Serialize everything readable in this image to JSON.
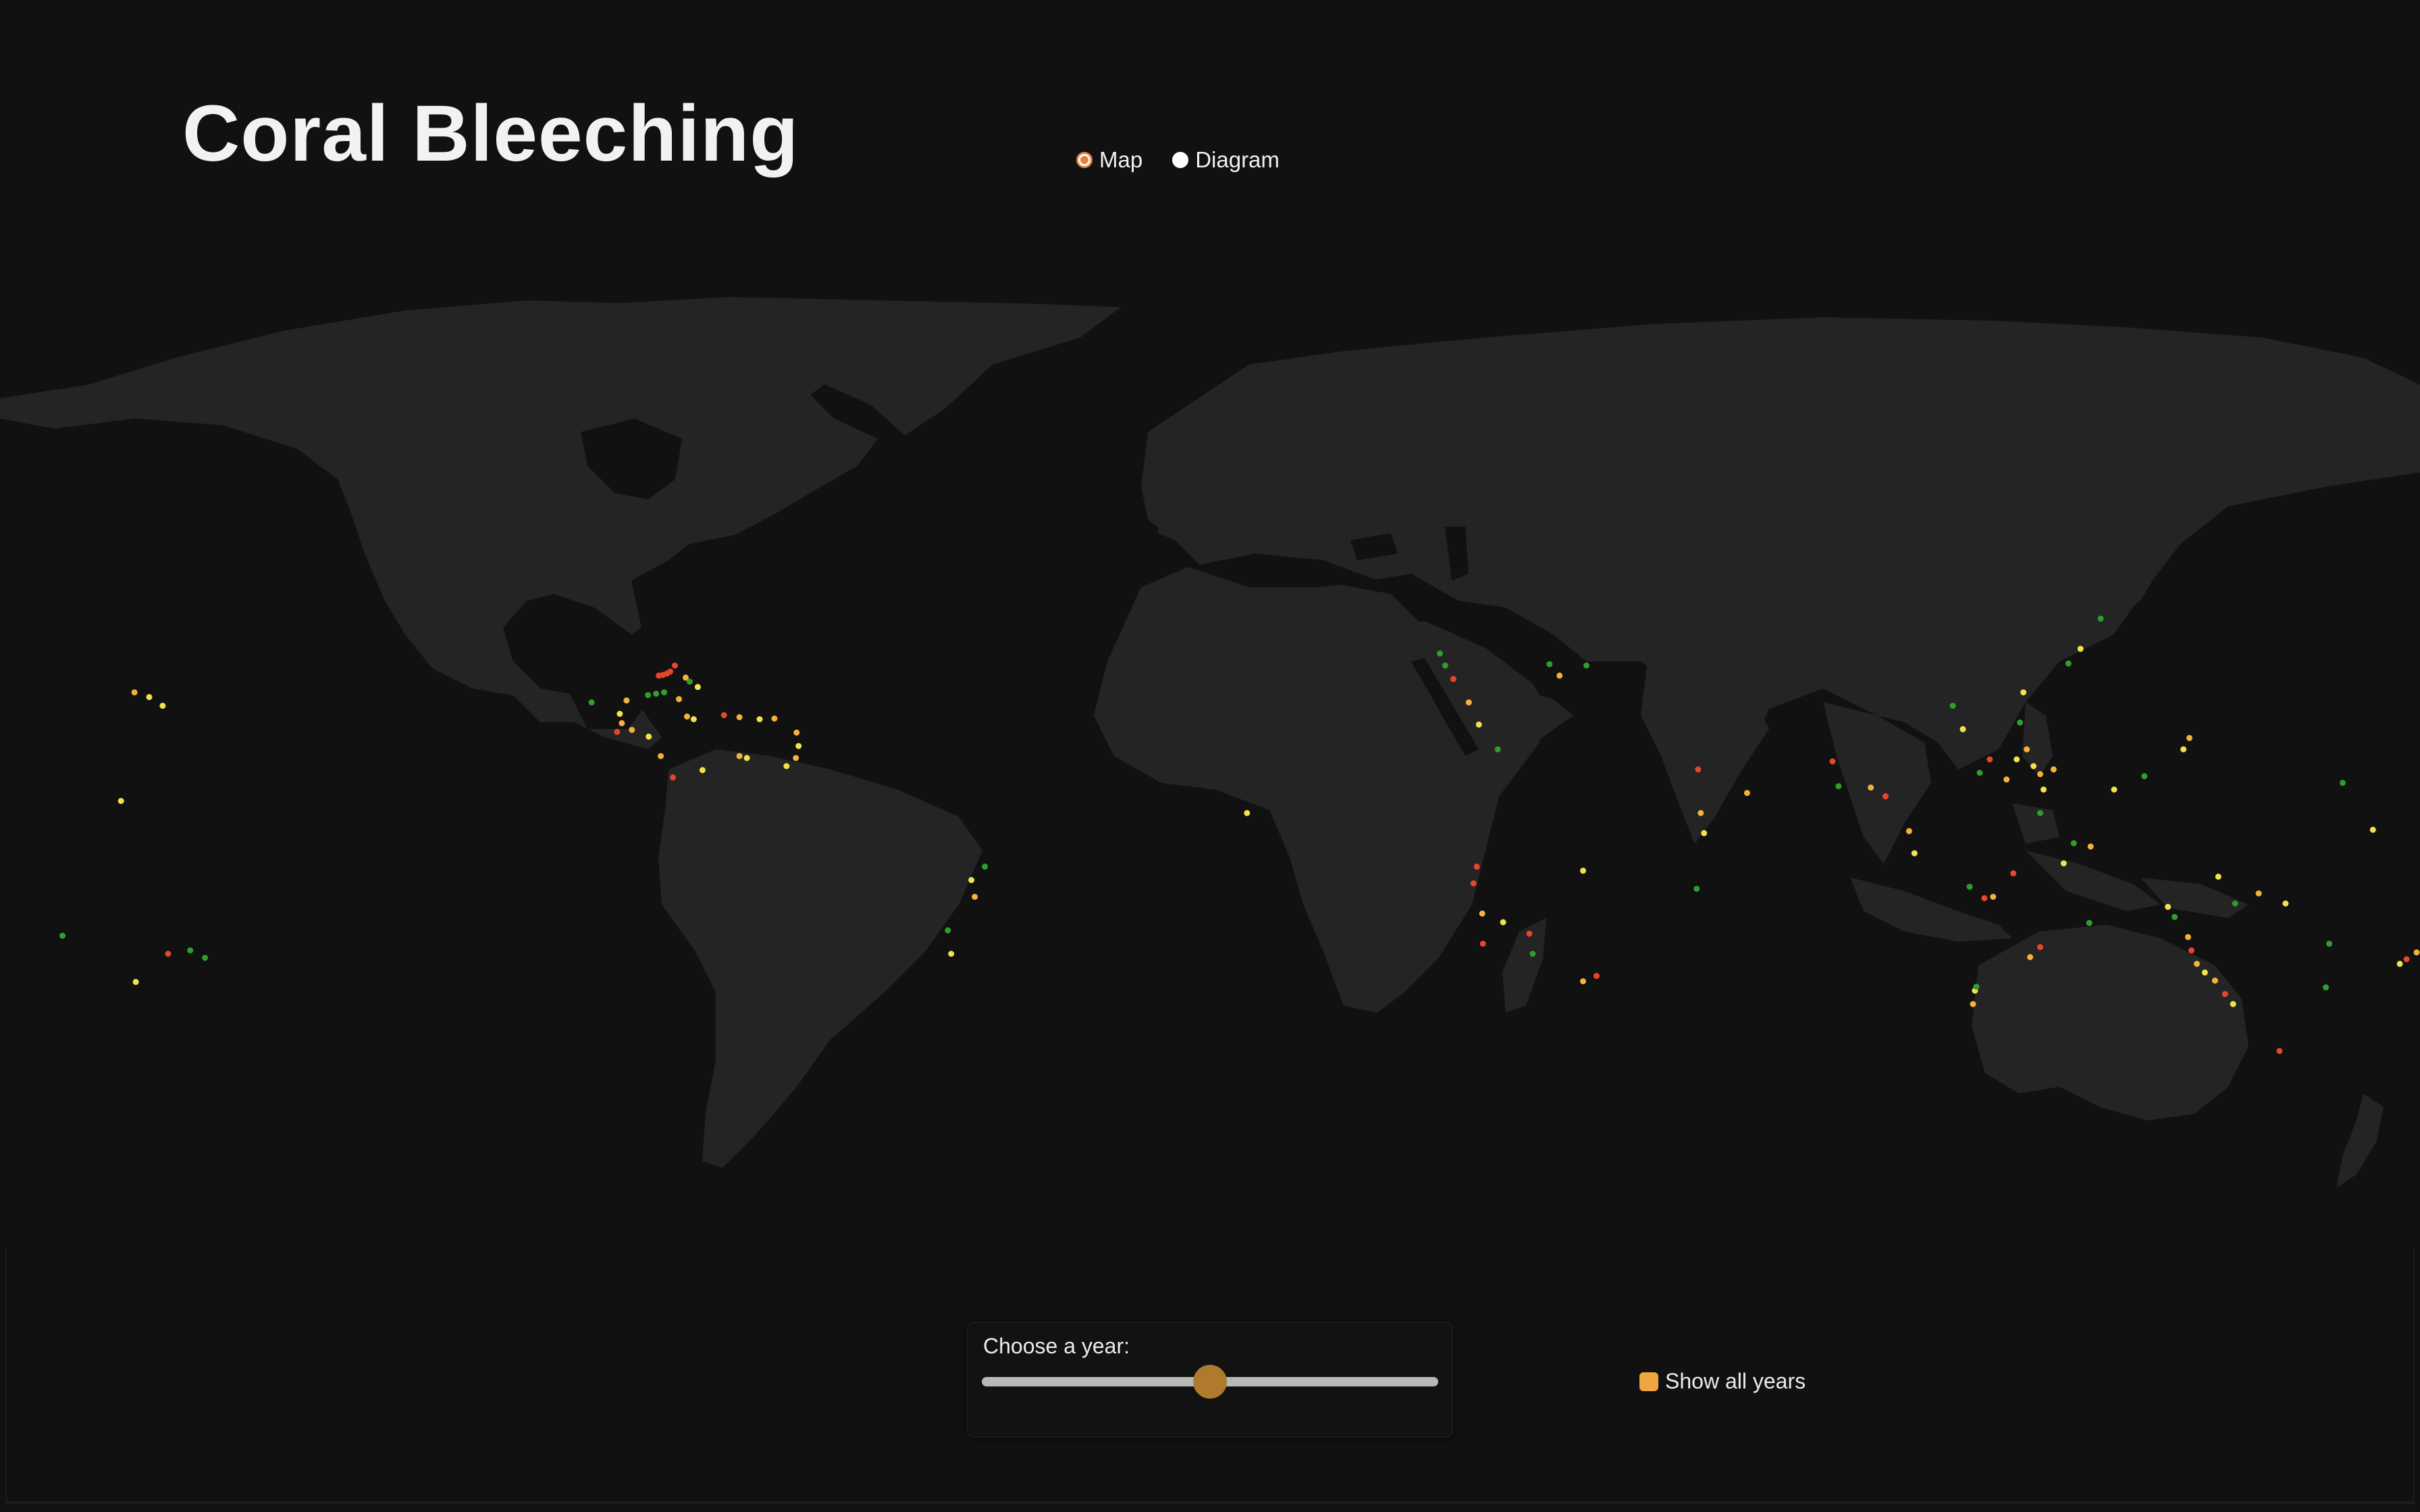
{
  "title": "Coral Bleeching",
  "view_toggle": {
    "options": [
      {
        "label": "Map",
        "checked": true
      },
      {
        "label": "Diagram",
        "checked": false
      }
    ]
  },
  "year_slider": {
    "label": "Choose a year:",
    "position_fraction": 0.5
  },
  "show_all": {
    "label": "Show all years",
    "checked": true,
    "color": "#f0a540"
  },
  "colors": {
    "background": "#111111",
    "land": "#242424",
    "accent": "#e0823f",
    "slider_thumb": "#b07a2e",
    "slider_track": "#b8b8b8",
    "severity_high": "#e8452c",
    "severity_medium": "#f4b23a",
    "severity_low": "#f2e34a",
    "severity_none": "#2f9e2f"
  },
  "map": {
    "projection": "equirectangular",
    "marker_legend": [
      "severity_high",
      "severity_medium",
      "severity_low",
      "severity_none"
    ],
    "bleaching_sites": [
      {
        "lon": -80.3,
        "lat": 25.1,
        "level": "high"
      },
      {
        "lon": -80.8,
        "lat": 24.8,
        "level": "high"
      },
      {
        "lon": -81.4,
        "lat": 24.6,
        "level": "high"
      },
      {
        "lon": -82.0,
        "lat": 24.5,
        "level": "high"
      },
      {
        "lon": -79.6,
        "lat": 26.0,
        "level": "high"
      },
      {
        "lon": -78.0,
        "lat": 24.2,
        "level": "medium"
      },
      {
        "lon": -77.4,
        "lat": 23.6,
        "level": "none"
      },
      {
        "lon": -76.2,
        "lat": 22.8,
        "level": "low"
      },
      {
        "lon": -81.2,
        "lat": 22.0,
        "level": "none"
      },
      {
        "lon": -82.4,
        "lat": 21.8,
        "level": "none"
      },
      {
        "lon": -83.6,
        "lat": 21.6,
        "level": "none"
      },
      {
        "lon": -79.0,
        "lat": 21.0,
        "level": "medium"
      },
      {
        "lon": -77.8,
        "lat": 18.4,
        "level": "medium"
      },
      {
        "lon": -76.8,
        "lat": 18.0,
        "level": "low"
      },
      {
        "lon": -72.3,
        "lat": 18.6,
        "level": "high"
      },
      {
        "lon": -70.0,
        "lat": 18.3,
        "level": "medium"
      },
      {
        "lon": -67.0,
        "lat": 18.0,
        "level": "low"
      },
      {
        "lon": -64.8,
        "lat": 18.1,
        "level": "medium"
      },
      {
        "lon": -61.5,
        "lat": 16.0,
        "level": "medium"
      },
      {
        "lon": -61.2,
        "lat": 14.0,
        "level": "low"
      },
      {
        "lon": -61.6,
        "lat": 12.2,
        "level": "medium"
      },
      {
        "lon": -63.0,
        "lat": 11.0,
        "level": "low"
      },
      {
        "lon": -68.9,
        "lat": 12.2,
        "level": "low"
      },
      {
        "lon": -70.0,
        "lat": 12.5,
        "level": "medium"
      },
      {
        "lon": -75.5,
        "lat": 10.4,
        "level": "low"
      },
      {
        "lon": -79.9,
        "lat": 9.3,
        "level": "high"
      },
      {
        "lon": -81.7,
        "lat": 12.5,
        "level": "medium"
      },
      {
        "lon": -83.5,
        "lat": 15.4,
        "level": "low"
      },
      {
        "lon": -86.0,
        "lat": 16.4,
        "level": "medium"
      },
      {
        "lon": -87.5,
        "lat": 17.4,
        "level": "medium"
      },
      {
        "lon": -87.8,
        "lat": 18.8,
        "level": "low"
      },
      {
        "lon": -86.8,
        "lat": 20.8,
        "level": "medium"
      },
      {
        "lon": -88.2,
        "lat": 16.1,
        "level": "high"
      },
      {
        "lon": -92.0,
        "lat": 20.5,
        "level": "none"
      },
      {
        "lon": -155.8,
        "lat": 20.0,
        "level": "low"
      },
      {
        "lon": -157.8,
        "lat": 21.3,
        "level": "low"
      },
      {
        "lon": -160.0,
        "lat": 22.0,
        "level": "medium"
      },
      {
        "lon": -162.0,
        "lat": 5.8,
        "level": "low"
      },
      {
        "lon": -149.5,
        "lat": -17.6,
        "level": "none"
      },
      {
        "lon": -151.7,
        "lat": -16.5,
        "level": "none"
      },
      {
        "lon": -155.0,
        "lat": -17.0,
        "level": "high"
      },
      {
        "lon": -159.8,
        "lat": -21.2,
        "level": "low"
      },
      {
        "lon": -170.7,
        "lat": -14.3,
        "level": "none"
      },
      {
        "lon": -35.0,
        "lat": -8.5,
        "level": "medium"
      },
      {
        "lon": -35.5,
        "lat": -6.0,
        "level": "low"
      },
      {
        "lon": -33.5,
        "lat": -4.0,
        "level": "none"
      },
      {
        "lon": -39.0,
        "lat": -13.5,
        "level": "none"
      },
      {
        "lon": -38.5,
        "lat": -17.0,
        "level": "low"
      },
      {
        "lon": 5.5,
        "lat": 4.0,
        "level": "low"
      },
      {
        "lon": 34.2,
        "lat": 27.8,
        "level": "none"
      },
      {
        "lon": 35.0,
        "lat": 26.0,
        "level": "none"
      },
      {
        "lon": 36.2,
        "lat": 24.0,
        "level": "high"
      },
      {
        "lon": 38.5,
        "lat": 20.5,
        "level": "medium"
      },
      {
        "lon": 40.0,
        "lat": 17.2,
        "level": "low"
      },
      {
        "lon": 42.8,
        "lat": 13.5,
        "level": "none"
      },
      {
        "lon": 50.5,
        "lat": 26.2,
        "level": "none"
      },
      {
        "lon": 52.0,
        "lat": 24.5,
        "level": "medium"
      },
      {
        "lon": 56.0,
        "lat": 26.0,
        "level": "none"
      },
      {
        "lon": 39.7,
        "lat": -4.0,
        "level": "high"
      },
      {
        "lon": 39.2,
        "lat": -6.5,
        "level": "high"
      },
      {
        "lon": 40.5,
        "lat": -11.0,
        "level": "medium"
      },
      {
        "lon": 40.6,
        "lat": -15.5,
        "level": "high"
      },
      {
        "lon": 43.6,
        "lat": -12.3,
        "level": "low"
      },
      {
        "lon": 47.5,
        "lat": -14.0,
        "level": "high"
      },
      {
        "lon": 48.0,
        "lat": -17.0,
        "level": "none"
      },
      {
        "lon": 55.5,
        "lat": -4.6,
        "level": "low"
      },
      {
        "lon": 57.5,
        "lat": -20.3,
        "level": "high"
      },
      {
        "lon": 55.5,
        "lat": -21.1,
        "level": "medium"
      },
      {
        "lon": 73.0,
        "lat": 4.0,
        "level": "medium"
      },
      {
        "lon": 73.5,
        "lat": 1.0,
        "level": "low"
      },
      {
        "lon": 72.6,
        "lat": 10.5,
        "level": "high"
      },
      {
        "lon": 72.4,
        "lat": -7.3,
        "level": "none"
      },
      {
        "lon": 79.9,
        "lat": 7.0,
        "level": "medium"
      },
      {
        "lon": 92.6,
        "lat": 11.7,
        "level": "high"
      },
      {
        "lon": 93.5,
        "lat": 8.0,
        "level": "none"
      },
      {
        "lon": 98.3,
        "lat": 7.8,
        "level": "medium"
      },
      {
        "lon": 100.5,
        "lat": 6.5,
        "level": "high"
      },
      {
        "lon": 104.0,
        "lat": 1.3,
        "level": "medium"
      },
      {
        "lon": 104.8,
        "lat": -2.0,
        "level": "low"
      },
      {
        "lon": 110.5,
        "lat": 20.0,
        "level": "none"
      },
      {
        "lon": 112.0,
        "lat": 16.5,
        "level": "low"
      },
      {
        "lon": 114.5,
        "lat": 10.0,
        "level": "none"
      },
      {
        "lon": 116.0,
        "lat": 12.0,
        "level": "high"
      },
      {
        "lon": 118.5,
        "lat": 9.0,
        "level": "medium"
      },
      {
        "lon": 120.0,
        "lat": 12.0,
        "level": "low"
      },
      {
        "lon": 121.5,
        "lat": 13.5,
        "level": "medium"
      },
      {
        "lon": 122.5,
        "lat": 11.0,
        "level": "low"
      },
      {
        "lon": 123.5,
        "lat": 9.8,
        "level": "medium"
      },
      {
        "lon": 124.0,
        "lat": 7.5,
        "level": "low"
      },
      {
        "lon": 125.5,
        "lat": 10.5,
        "level": "medium"
      },
      {
        "lon": 120.5,
        "lat": 17.5,
        "level": "none"
      },
      {
        "lon": 121.0,
        "lat": 22.0,
        "level": "low"
      },
      {
        "lon": 123.5,
        "lat": 4.0,
        "level": "none"
      },
      {
        "lon": 119.5,
        "lat": -5.0,
        "level": "high"
      },
      {
        "lon": 115.2,
        "lat": -8.7,
        "level": "high"
      },
      {
        "lon": 116.5,
        "lat": -8.5,
        "level": "medium"
      },
      {
        "lon": 113.0,
        "lat": -7.0,
        "level": "none"
      },
      {
        "lon": 127.0,
        "lat": -3.5,
        "level": "low"
      },
      {
        "lon": 128.5,
        "lat": -0.5,
        "level": "none"
      },
      {
        "lon": 131.0,
        "lat": -1.0,
        "level": "medium"
      },
      {
        "lon": 134.5,
        "lat": 7.5,
        "level": "low"
      },
      {
        "lon": 139.0,
        "lat": 9.5,
        "level": "none"
      },
      {
        "lon": 144.8,
        "lat": 13.5,
        "level": "low"
      },
      {
        "lon": 145.7,
        "lat": 15.2,
        "level": "medium"
      },
      {
        "lon": 127.7,
        "lat": 26.3,
        "level": "none"
      },
      {
        "lon": 129.5,
        "lat": 28.5,
        "level": "low"
      },
      {
        "lon": 132.5,
        "lat": 33.0,
        "level": "none"
      },
      {
        "lon": 150.0,
        "lat": -5.5,
        "level": "low"
      },
      {
        "lon": 152.5,
        "lat": -9.5,
        "level": "none"
      },
      {
        "lon": 156.0,
        "lat": -8.0,
        "level": "medium"
      },
      {
        "lon": 160.0,
        "lat": -9.5,
        "level": "low"
      },
      {
        "lon": 166.5,
        "lat": -15.5,
        "level": "none"
      },
      {
        "lon": 166.0,
        "lat": -22.0,
        "level": "none"
      },
      {
        "lon": 178.0,
        "lat": -17.8,
        "level": "high"
      },
      {
        "lon": 179.5,
        "lat": -16.8,
        "level": "medium"
      },
      {
        "lon": 177.0,
        "lat": -18.5,
        "level": "low"
      },
      {
        "lon": 173.0,
        "lat": 1.5,
        "level": "low"
      },
      {
        "lon": 168.5,
        "lat": 8.5,
        "level": "none"
      },
      {
        "lon": 145.5,
        "lat": -14.5,
        "level": "medium"
      },
      {
        "lon": 146.0,
        "lat": -16.5,
        "level": "high"
      },
      {
        "lon": 146.8,
        "lat": -18.5,
        "level": "medium"
      },
      {
        "lon": 148.0,
        "lat": -19.8,
        "level": "low"
      },
      {
        "lon": 149.5,
        "lat": -21.0,
        "level": "medium"
      },
      {
        "lon": 151.0,
        "lat": -23.0,
        "level": "high"
      },
      {
        "lon": 152.2,
        "lat": -24.5,
        "level": "low"
      },
      {
        "lon": 143.5,
        "lat": -11.5,
        "level": "none"
      },
      {
        "lon": 142.5,
        "lat": -10.0,
        "level": "low"
      },
      {
        "lon": 130.8,
        "lat": -12.4,
        "level": "none"
      },
      {
        "lon": 123.5,
        "lat": -16.0,
        "level": "high"
      },
      {
        "lon": 122.0,
        "lat": -17.5,
        "level": "medium"
      },
      {
        "lon": 113.8,
        "lat": -22.5,
        "level": "low"
      },
      {
        "lon": 113.5,
        "lat": -24.5,
        "level": "medium"
      },
      {
        "lon": 114.0,
        "lat": -21.9,
        "level": "none"
      },
      {
        "lon": 159.1,
        "lat": -31.5,
        "level": "high"
      }
    ]
  }
}
